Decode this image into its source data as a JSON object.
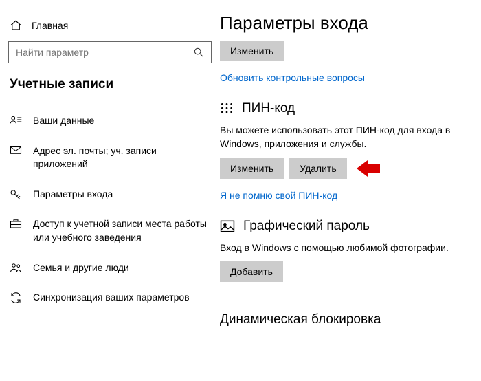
{
  "sidebar": {
    "home_label": "Главная",
    "search_placeholder": "Найти параметр",
    "section_title": "Учетные записи",
    "items": [
      {
        "label": "Ваши данные"
      },
      {
        "label": "Адрес эл. почты; уч. записи приложений"
      },
      {
        "label": "Параметры входа"
      },
      {
        "label": "Доступ к учетной записи места работы или учебного заведения"
      },
      {
        "label": "Семья и другие люди"
      },
      {
        "label": "Синхронизация ваших параметров"
      }
    ]
  },
  "main": {
    "title": "Параметры входа",
    "top_change_btn": "Изменить",
    "update_questions_link": "Обновить контрольные вопросы",
    "pin": {
      "header": "ПИН-код",
      "desc": "Вы можете использовать этот ПИН-код для входа в Windows, приложения и службы.",
      "change_btn": "Изменить",
      "delete_btn": "Удалить",
      "forgot_link": "Я не помню свой ПИН-код"
    },
    "picture": {
      "header": "Графический пароль",
      "desc": "Вход в Windows с помощью любимой фотографии.",
      "add_btn": "Добавить"
    },
    "dynamic_lock_header": "Динамическая блокировка"
  }
}
